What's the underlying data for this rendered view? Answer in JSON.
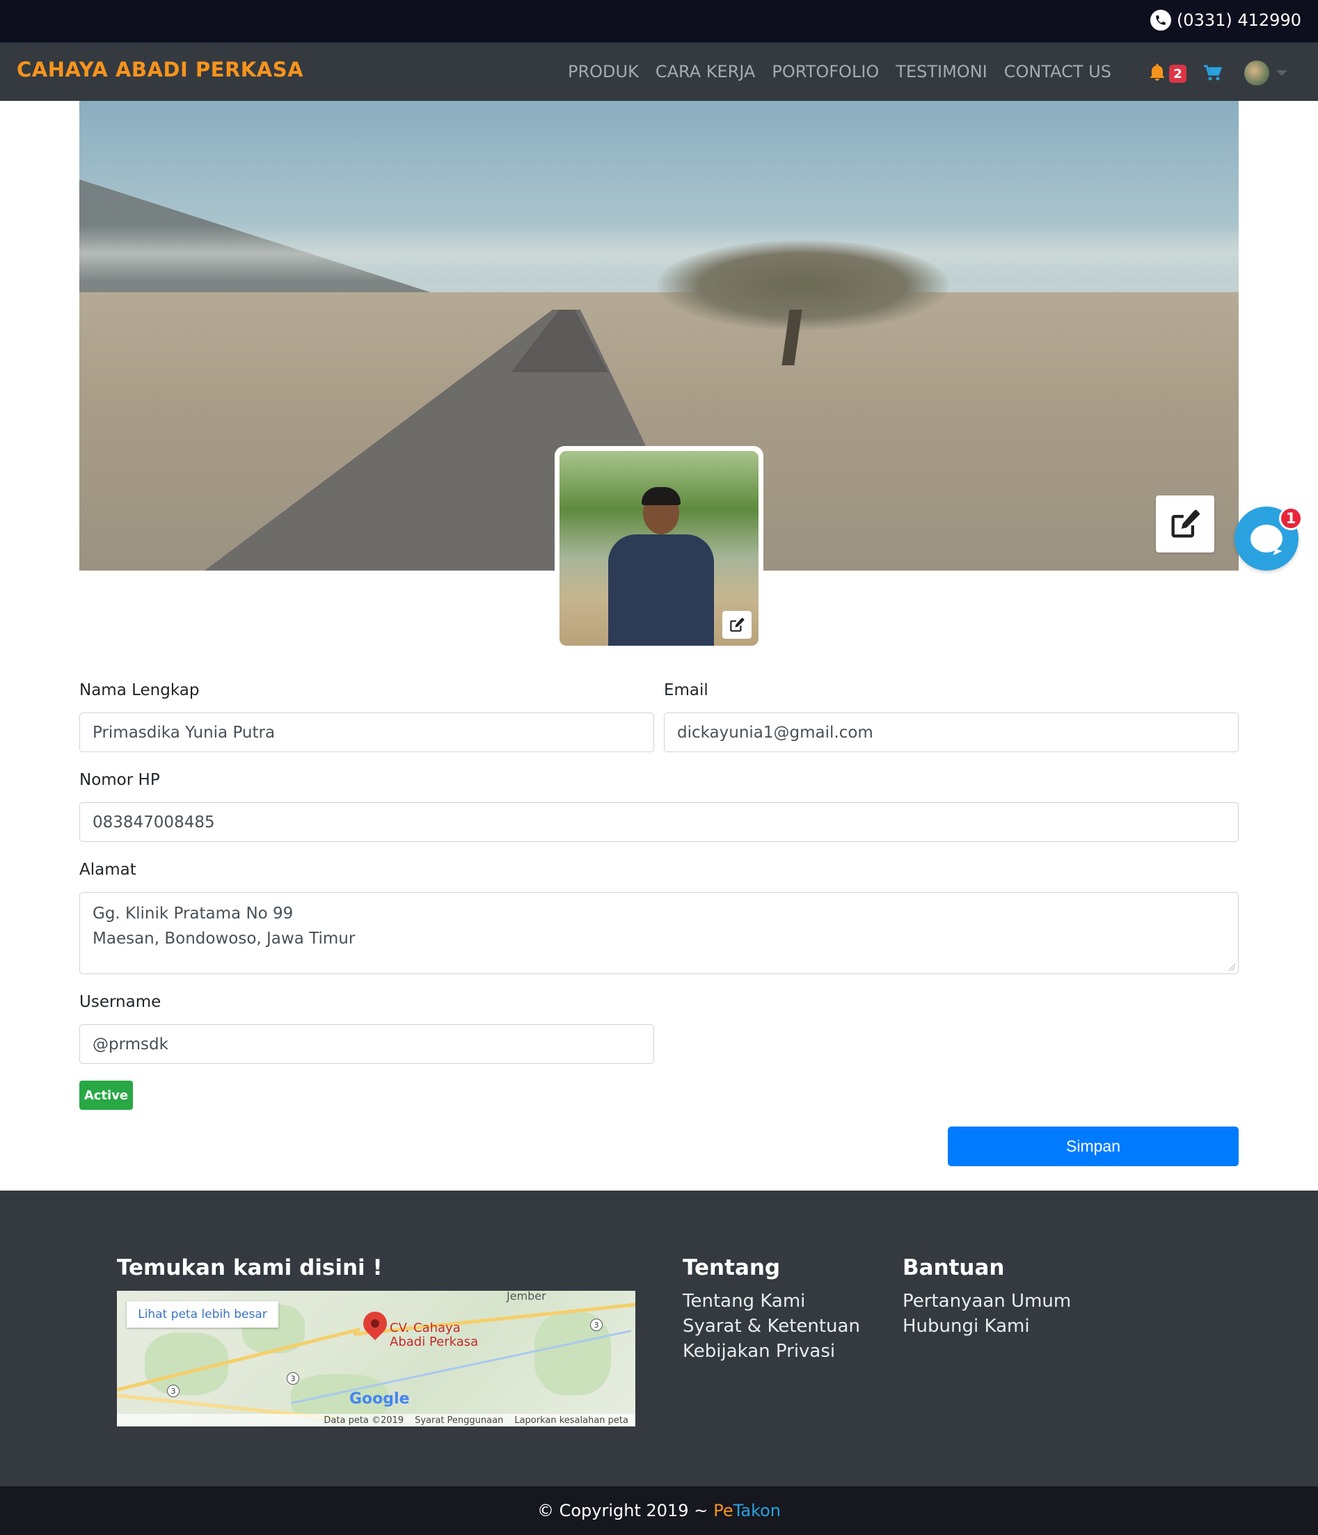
{
  "topbar": {
    "phone": "(0331) 412990",
    "phone_icon": "phone-icon"
  },
  "navbar": {
    "brand": "CAHAYA ABADI PERKASA",
    "links": [
      "PRODUK",
      "CARA KERJA",
      "PORTOFOLIO",
      "TESTIMONI",
      "CONTACT US"
    ],
    "notification_count": "2",
    "icons": [
      "bell-icon",
      "cart-icon",
      "user-avatar",
      "chevron-down-icon"
    ]
  },
  "chat": {
    "badge": "1"
  },
  "form": {
    "full_name": {
      "label": "Nama Lengkap",
      "value": "Primasdika Yunia Putra"
    },
    "email": {
      "label": "Email",
      "value": "dickayunia1@gmail.com"
    },
    "phone": {
      "label": "Nomor HP",
      "value": "083847008485"
    },
    "address": {
      "label": "Alamat",
      "line1": "Gg. Klinik Pratama No 99",
      "line2": "Maesan, Bondowoso, Jawa Timur"
    },
    "username": {
      "label": "Username",
      "value": "@prmsdk"
    },
    "status": "Active",
    "save_label": "Simpan"
  },
  "footer": {
    "find_us_title": "Temukan kami disini !",
    "map": {
      "larger_map": "Lihat peta lebih besar",
      "place": [
        "CV. Cahaya",
        "Abadi Perkasa"
      ],
      "city": "Jember",
      "google": "Google",
      "data_credit": "Data peta ©2019",
      "terms": "Syarat Penggunaan",
      "report": "Laporkan kesalahan peta",
      "route_number": "3"
    },
    "about_title": "Tentang",
    "about_links": [
      "Tentang Kami",
      "Syarat & Ketentuan",
      "Kebijakan Privasi"
    ],
    "help_title": "Bantuan",
    "help_links": [
      "Pertanyaan Umum",
      "Hubungi Kami"
    ]
  },
  "copyright": {
    "prefix": "© Copyright 2019 ~",
    "brand_pe": "Pe",
    "brand_takon": "Takon"
  },
  "colors": {
    "brand_orange": "#f7941d",
    "primary": "#007bff",
    "success": "#28a745",
    "chat_blue": "#2aa2e0",
    "danger": "#dc3545"
  }
}
